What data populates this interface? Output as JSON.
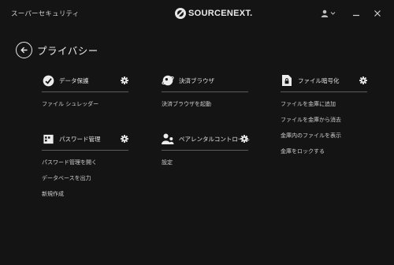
{
  "window": {
    "app_title": "スーパーセキュリティ",
    "brand": "SOURCENEXT."
  },
  "header": {
    "title": "プライバシー"
  },
  "sections": {
    "data_protect": {
      "title": "データ保護",
      "links": [
        "ファイル シュレッダー"
      ]
    },
    "password": {
      "title": "パスワード管理",
      "links": [
        "パスワード管理を開く",
        "データベースを出力",
        "新規作成"
      ]
    },
    "browser": {
      "title": "決済ブラウザ",
      "links": [
        "決済ブラウザを起動"
      ]
    },
    "parental": {
      "title": "ペアレンタルコントロール",
      "links": [
        "設定"
      ]
    },
    "encryption": {
      "title": "ファイル暗号化",
      "links": [
        "ファイルを金庫に追加",
        "ファイルを金庫から消去",
        "金庫内のファイルを表示",
        "金庫をロックする"
      ]
    }
  },
  "colors": {
    "background": "#141414",
    "text": "#d8d8d8",
    "divider": "#5c5c5c"
  }
}
